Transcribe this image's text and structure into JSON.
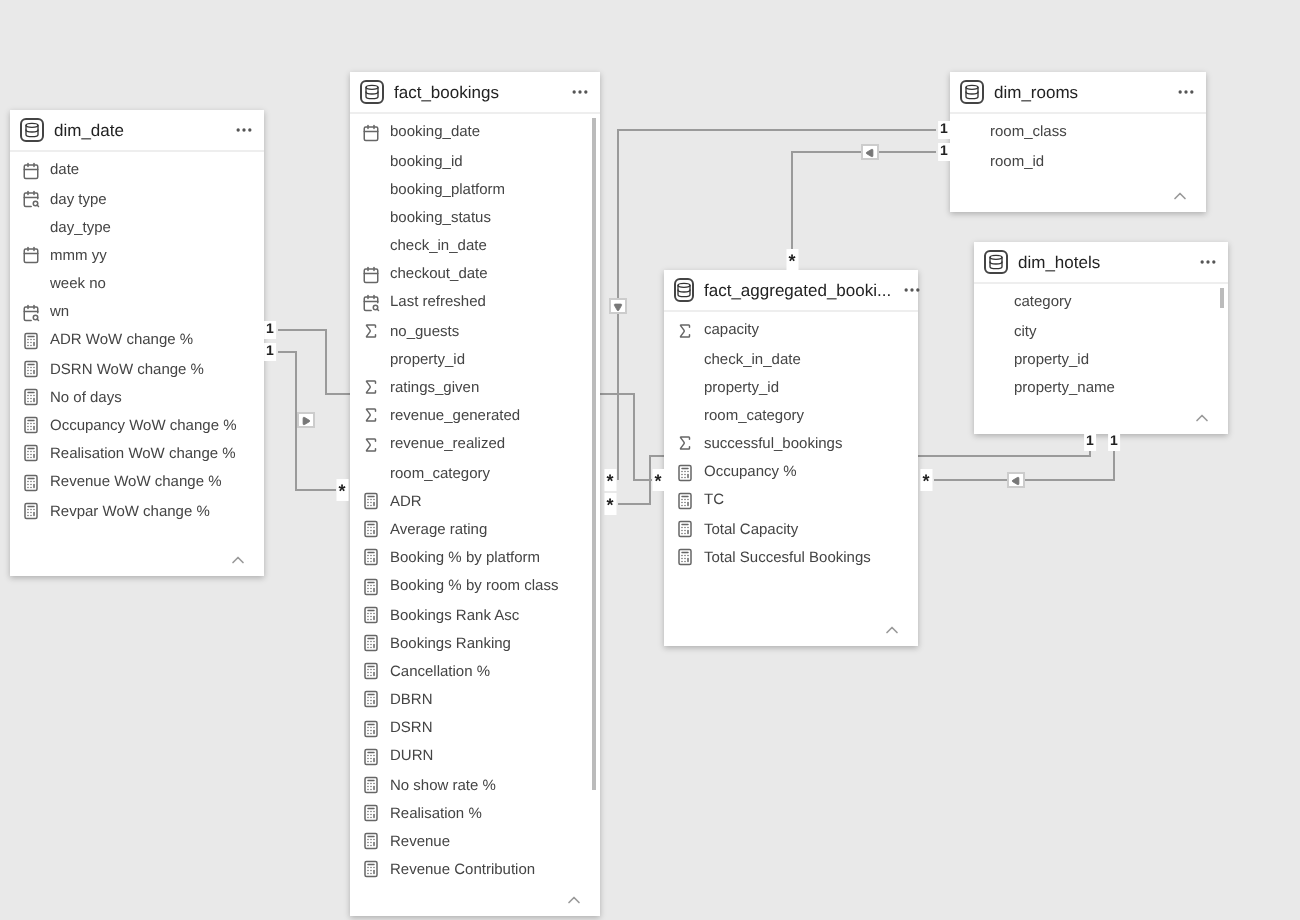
{
  "tables": [
    {
      "name": "dim_date",
      "fields": [
        {
          "kind": "date",
          "label": "date"
        },
        {
          "kind": "hierarchy",
          "label": "day type"
        },
        {
          "kind": "plain",
          "label": "day_type"
        },
        {
          "kind": "date",
          "label": "mmm yy"
        },
        {
          "kind": "plain",
          "label": "week no"
        },
        {
          "kind": "hierarchy",
          "label": "wn"
        },
        {
          "kind": "measure",
          "label": "ADR WoW change %"
        },
        {
          "kind": "measure",
          "label": "DSRN WoW change %"
        },
        {
          "kind": "measure",
          "label": "No of days"
        },
        {
          "kind": "measure",
          "label": "Occupancy WoW change %"
        },
        {
          "kind": "measure",
          "label": "Realisation WoW change %"
        },
        {
          "kind": "measure",
          "label": "Revenue WoW change %"
        },
        {
          "kind": "measure",
          "label": "Revpar WoW change %"
        }
      ]
    },
    {
      "name": "fact_bookings",
      "fields": [
        {
          "kind": "date",
          "label": "booking_date"
        },
        {
          "kind": "plain",
          "label": "booking_id"
        },
        {
          "kind": "plain",
          "label": "booking_platform"
        },
        {
          "kind": "plain",
          "label": "booking_status"
        },
        {
          "kind": "plain",
          "label": "check_in_date"
        },
        {
          "kind": "date",
          "label": "checkout_date"
        },
        {
          "kind": "hierarchy",
          "label": "Last refreshed"
        },
        {
          "kind": "sum",
          "label": "no_guests"
        },
        {
          "kind": "plain",
          "label": "property_id"
        },
        {
          "kind": "sum",
          "label": "ratings_given"
        },
        {
          "kind": "sum",
          "label": "revenue_generated"
        },
        {
          "kind": "sum",
          "label": "revenue_realized"
        },
        {
          "kind": "plain",
          "label": "room_category"
        },
        {
          "kind": "measure",
          "label": "ADR"
        },
        {
          "kind": "measure",
          "label": "Average rating"
        },
        {
          "kind": "measure",
          "label": "Booking % by platform"
        },
        {
          "kind": "measure",
          "label": "Booking % by room class"
        },
        {
          "kind": "measure",
          "label": "Bookings Rank Asc"
        },
        {
          "kind": "measure",
          "label": "Bookings Ranking"
        },
        {
          "kind": "measure",
          "label": "Cancellation %"
        },
        {
          "kind": "measure",
          "label": "DBRN"
        },
        {
          "kind": "measure",
          "label": "DSRN"
        },
        {
          "kind": "measure",
          "label": "DURN"
        },
        {
          "kind": "measure",
          "label": "No show rate %"
        },
        {
          "kind": "measure",
          "label": "Realisation %"
        },
        {
          "kind": "measure",
          "label": "Revenue"
        },
        {
          "kind": "measure",
          "label": "Revenue Contribution"
        }
      ]
    },
    {
      "name": "dim_rooms",
      "fields": [
        {
          "kind": "plain",
          "label": "room_class"
        },
        {
          "kind": "plain",
          "label": "room_id"
        }
      ]
    },
    {
      "name": "fact_aggregated_booki...",
      "fields": [
        {
          "kind": "sum",
          "label": "capacity"
        },
        {
          "kind": "plain",
          "label": "check_in_date"
        },
        {
          "kind": "plain",
          "label": "property_id"
        },
        {
          "kind": "plain",
          "label": "room_category"
        },
        {
          "kind": "sum",
          "label": "successful_bookings"
        },
        {
          "kind": "measure",
          "label": "Occupancy %"
        },
        {
          "kind": "measure",
          "label": "TC"
        },
        {
          "kind": "measure",
          "label": "Total Capacity"
        },
        {
          "kind": "measure",
          "label": "Total Succesful Bookings"
        }
      ]
    },
    {
      "name": "dim_hotels",
      "fields": [
        {
          "kind": "plain",
          "label": "category"
        },
        {
          "kind": "plain",
          "label": "city"
        },
        {
          "kind": "plain",
          "label": "property_id"
        },
        {
          "kind": "plain",
          "label": "property_name"
        }
      ]
    }
  ],
  "relationships": [
    {
      "one": "1",
      "many": "*"
    },
    {
      "one": "1",
      "many": "*"
    },
    {
      "one": "1",
      "many": "*"
    },
    {
      "one": "1",
      "many": "*"
    },
    {
      "one": "1",
      "many": "*"
    },
    {
      "one": "1",
      "many": "*"
    }
  ]
}
